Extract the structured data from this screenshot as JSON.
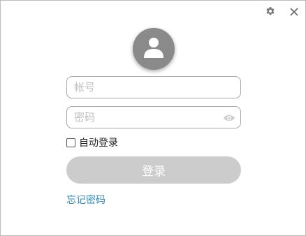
{
  "icons": {
    "settings": "gear-icon",
    "close": "close-icon",
    "avatar": "user-icon",
    "show_password": "eye-icon"
  },
  "colors": {
    "login_button_bg": "#cccccc",
    "link": "#2b8cc4",
    "avatar_bg": "#8a8a8a"
  },
  "form": {
    "account": {
      "placeholder": "帐号",
      "value": ""
    },
    "password": {
      "placeholder": "密码",
      "value": ""
    },
    "auto_login": {
      "label": "自动登录",
      "checked": false
    },
    "login_button": "登录",
    "forgot_password": "忘记密码"
  }
}
